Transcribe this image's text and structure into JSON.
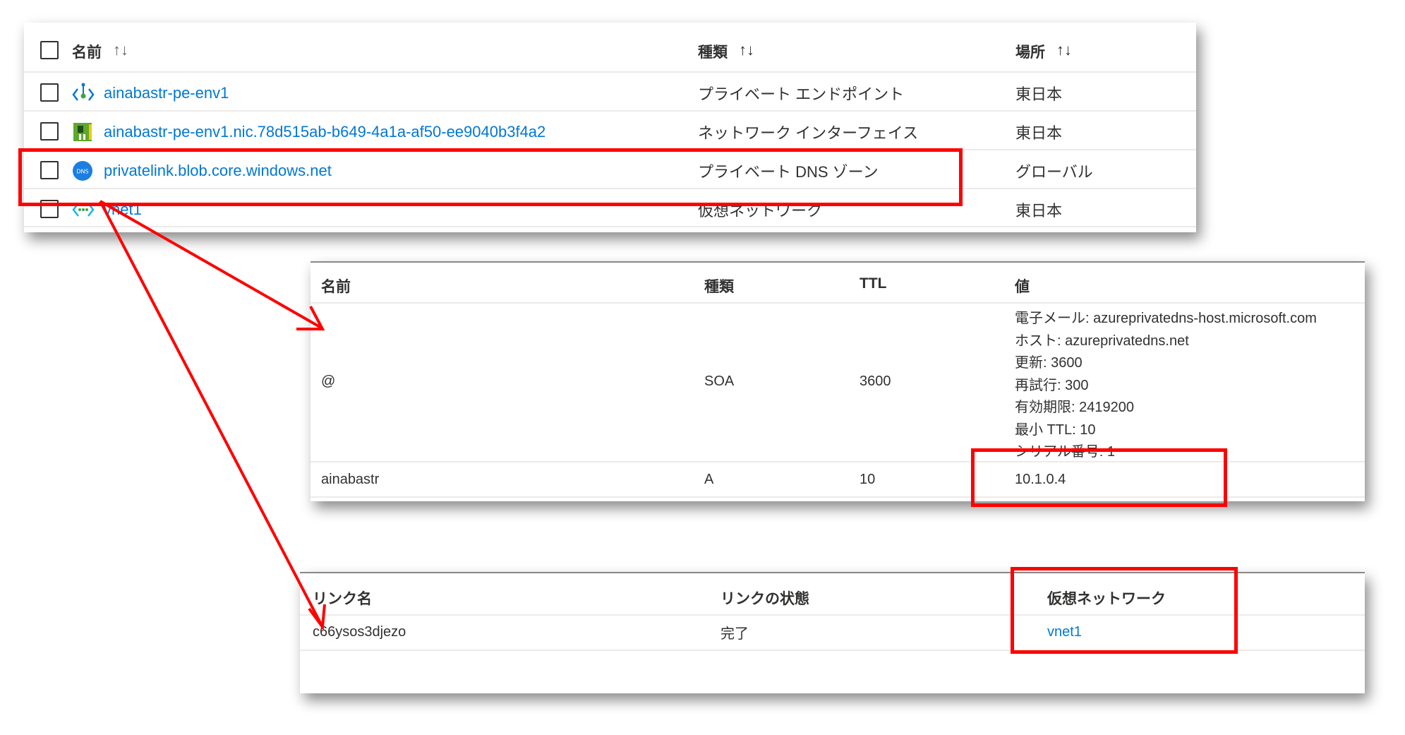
{
  "resources": {
    "headers": {
      "name": "名前",
      "type": "種類",
      "location": "場所",
      "sort": "↑↓"
    },
    "rows": [
      {
        "name": "ainabastr-pe-env1",
        "type": "プライベート エンドポイント",
        "location": "東日本",
        "icon": "private-endpoint-icon"
      },
      {
        "name": "ainabastr-pe-env1.nic.78d515ab-b649-4a1a-af50-ee9040b3f4a2",
        "type": "ネットワーク インターフェイス",
        "location": "東日本",
        "icon": "network-interface-icon"
      },
      {
        "name": "privatelink.blob.core.windows.net",
        "type": "プライベート DNS ゾーン",
        "location": "グローバル",
        "icon": "dns-zone-icon"
      },
      {
        "name": "vnet1",
        "type": "仮想ネットワーク",
        "location": "東日本",
        "icon": "virtual-network-icon"
      }
    ]
  },
  "records": {
    "headers": {
      "name": "名前",
      "type": "種類",
      "ttl": "TTL",
      "value": "値"
    },
    "rows": [
      {
        "name": "@",
        "type": "SOA",
        "ttl": "3600",
        "values": [
          "電子メール: azureprivatedns-host.microsoft.com",
          "ホスト: azureprivatedns.net",
          "更新: 3600",
          "再試行: 300",
          "有効期限: 2419200",
          "最小 TTL: 10",
          "シリアル番号: 1"
        ]
      },
      {
        "name": "ainabastr",
        "type": "A",
        "ttl": "10",
        "values": [
          "10.1.0.4"
        ]
      }
    ]
  },
  "links": {
    "headers": {
      "name": "リンク名",
      "state": "リンクの状態",
      "vnet": "仮想ネットワーク"
    },
    "rows": [
      {
        "name": "c66ysos3djezo",
        "state": "完了",
        "vnet": "vnet1"
      }
    ]
  },
  "colors": {
    "highlight": "#ff0000",
    "link": "#0078d4"
  }
}
